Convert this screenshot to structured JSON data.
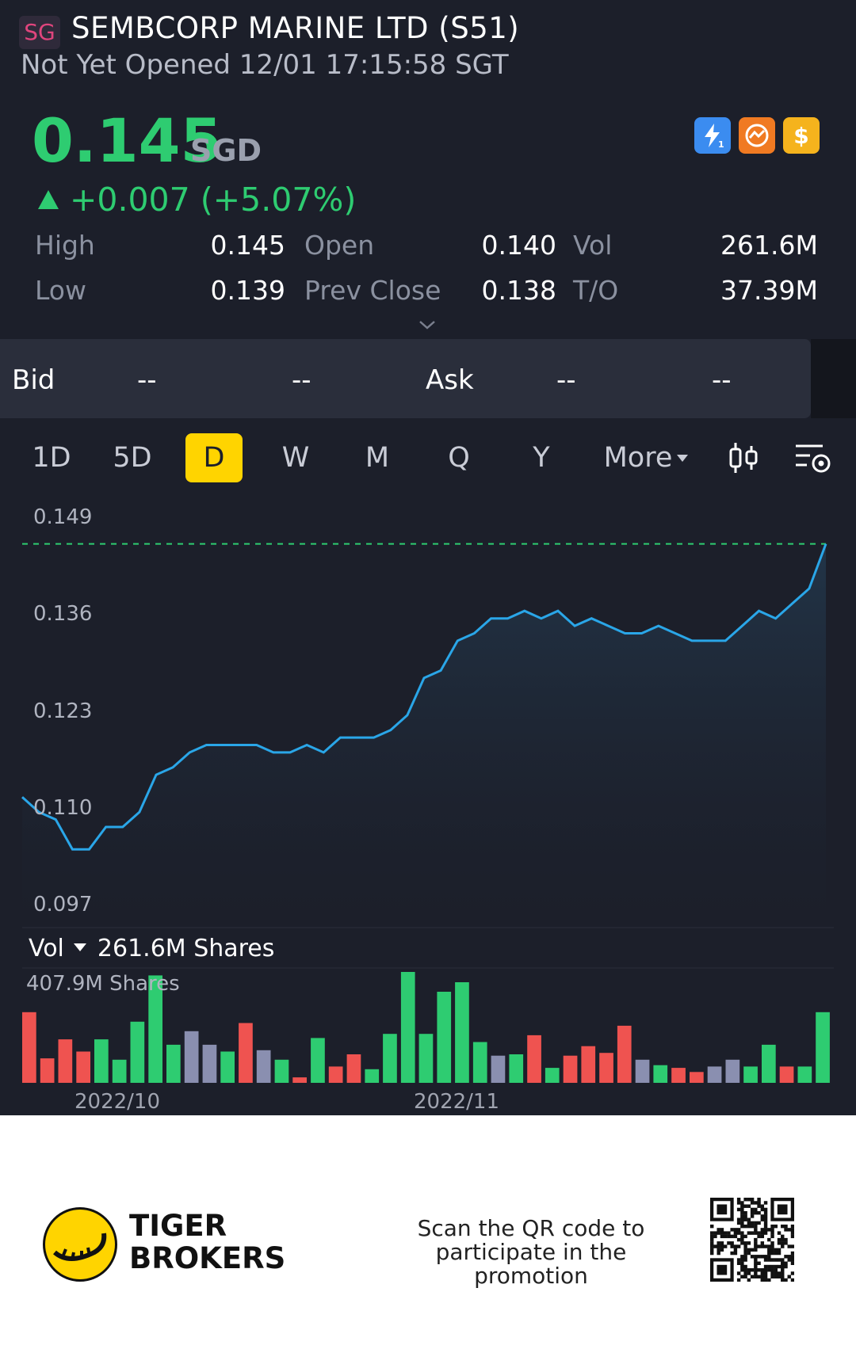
{
  "header": {
    "exchange_badge": "SG",
    "title": "SEMBCORP MARINE LTD (S51)",
    "status": "Not Yet Opened 12/01 17:15:58 SGT"
  },
  "quote": {
    "price": "0.145",
    "currency": "SGD",
    "change": "+0.007 (+5.07%)",
    "change_direction": "up",
    "badges": [
      "lightning-level1-icon",
      "chart-swap-icon",
      "dollar-icon"
    ]
  },
  "stats": {
    "high_label": "High",
    "high": "0.145",
    "low_label": "Low",
    "low": "0.139",
    "open_label": "Open",
    "open": "0.140",
    "prev_close_label": "Prev Close",
    "prev_close": "0.138",
    "vol_label": "Vol",
    "vol": "261.6M",
    "to_label": "T/O",
    "to": "37.39M"
  },
  "bidask": {
    "bid_label": "Bid",
    "bid_price": "--",
    "bid_size": "--",
    "ask_label": "Ask",
    "ask_price": "--",
    "ask_size": "--"
  },
  "tabs": {
    "items": [
      "1D",
      "5D",
      "D",
      "W",
      "M",
      "Q",
      "Y"
    ],
    "active": "D",
    "more_label": "More"
  },
  "volume": {
    "selector_label": "Vol",
    "current": "261.6M Shares",
    "max_label": "407.9M Shares"
  },
  "footer": {
    "brand_line1": "TIGER",
    "brand_line2": "BROKERS",
    "promo_line1": "Scan the QR code to",
    "promo_line2": "participate in the promotion"
  },
  "colors": {
    "up": "#2ecc71",
    "down": "#ef5350",
    "neutral": "#8a8fb0",
    "line": "#2aa6e8",
    "active_tab": "#ffd400"
  },
  "chart_data": [
    {
      "type": "area",
      "y_ticks": [
        "0.149",
        "0.136",
        "0.123",
        "0.110",
        "0.097"
      ],
      "ylim": [
        0.097,
        0.149
      ],
      "reference_line": 0.145,
      "x_labels": [
        "2022/10",
        "2022/11"
      ],
      "values": [
        0.111,
        0.109,
        0.108,
        0.104,
        0.104,
        0.107,
        0.107,
        0.109,
        0.114,
        0.115,
        0.117,
        0.118,
        0.118,
        0.118,
        0.118,
        0.117,
        0.117,
        0.118,
        0.117,
        0.119,
        0.119,
        0.119,
        0.12,
        0.122,
        0.127,
        0.128,
        0.132,
        0.133,
        0.135,
        0.135,
        0.136,
        0.135,
        0.136,
        0.134,
        0.135,
        0.134,
        0.133,
        0.133,
        0.134,
        0.133,
        0.132,
        0.132,
        0.132,
        0.134,
        0.136,
        0.135,
        0.137,
        0.139,
        0.145
      ]
    },
    {
      "type": "bar",
      "title": "Vol",
      "ylim": [
        0,
        407.9
      ],
      "values": [
        260,
        90,
        160,
        115,
        160,
        85,
        225,
        395,
        140,
        190,
        140,
        115,
        220,
        120,
        85,
        20,
        165,
        60,
        105,
        50,
        180,
        407.9,
        180,
        335,
        370,
        150,
        100,
        105,
        175,
        55,
        100,
        135,
        110,
        210,
        85,
        65,
        55,
        40,
        60,
        85,
        60,
        140,
        60,
        60,
        260
      ],
      "directions": [
        "down",
        "down",
        "down",
        "down",
        "up",
        "up",
        "up",
        "up",
        "up",
        "neutral",
        "neutral",
        "up",
        "down",
        "neutral",
        "up",
        "down",
        "up",
        "down",
        "down",
        "up",
        "up",
        "up",
        "up",
        "up",
        "up",
        "up",
        "neutral",
        "up",
        "down",
        "up",
        "down",
        "down",
        "down",
        "down",
        "neutral",
        "up",
        "down",
        "down",
        "neutral",
        "neutral",
        "up",
        "up",
        "down",
        "up",
        "up"
      ]
    }
  ]
}
